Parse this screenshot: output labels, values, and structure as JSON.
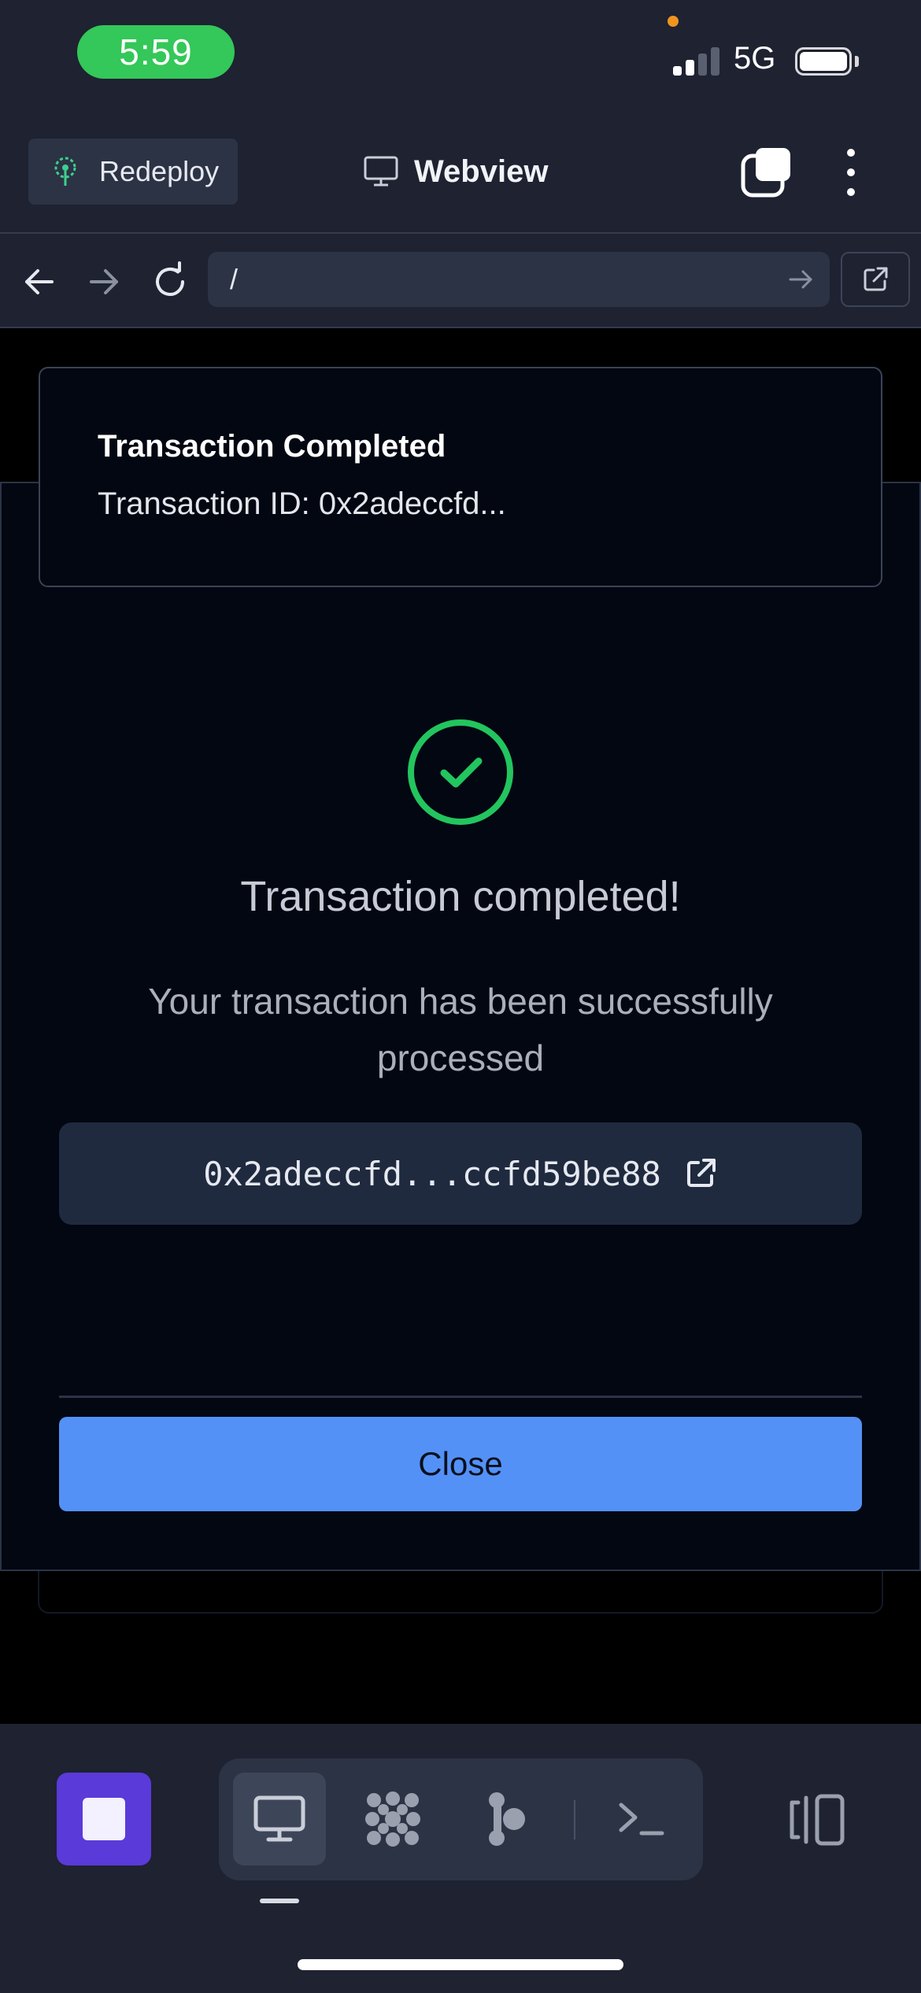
{
  "status_bar": {
    "time": "5:59",
    "network": "5G"
  },
  "header": {
    "redeploy_label": "Redeploy",
    "title": "Webview"
  },
  "url_bar": {
    "value": "/"
  },
  "toast": {
    "title": "Transaction Completed",
    "description": "Transaction ID: 0x2adeccfd..."
  },
  "modal": {
    "title": "Transaction completed!",
    "message": "Your transaction has been successfully processed",
    "tx_hash": "0x2adeccfd...ccfd59be88",
    "close_label": "Close"
  },
  "icons": {
    "header": [
      "redeploy-icon",
      "monitor-icon",
      "tabs-icon",
      "more-vertical-icon"
    ],
    "url_bar": [
      "back-arrow-icon",
      "forward-arrow-icon",
      "reload-icon",
      "go-arrow-icon",
      "external-link-icon"
    ],
    "modal": [
      "check-circle-icon",
      "external-link-icon"
    ],
    "toolbar": [
      "stop-icon",
      "monitor-icon",
      "dots-grid-icon",
      "branch-nodes-icon",
      "terminal-icon",
      "panel-toggle-icon"
    ]
  },
  "colors": {
    "success": "#22c55e",
    "primary_button": "#5391f6",
    "stop_button": "#5a3ad9",
    "status_time_pill": "#34c759"
  }
}
